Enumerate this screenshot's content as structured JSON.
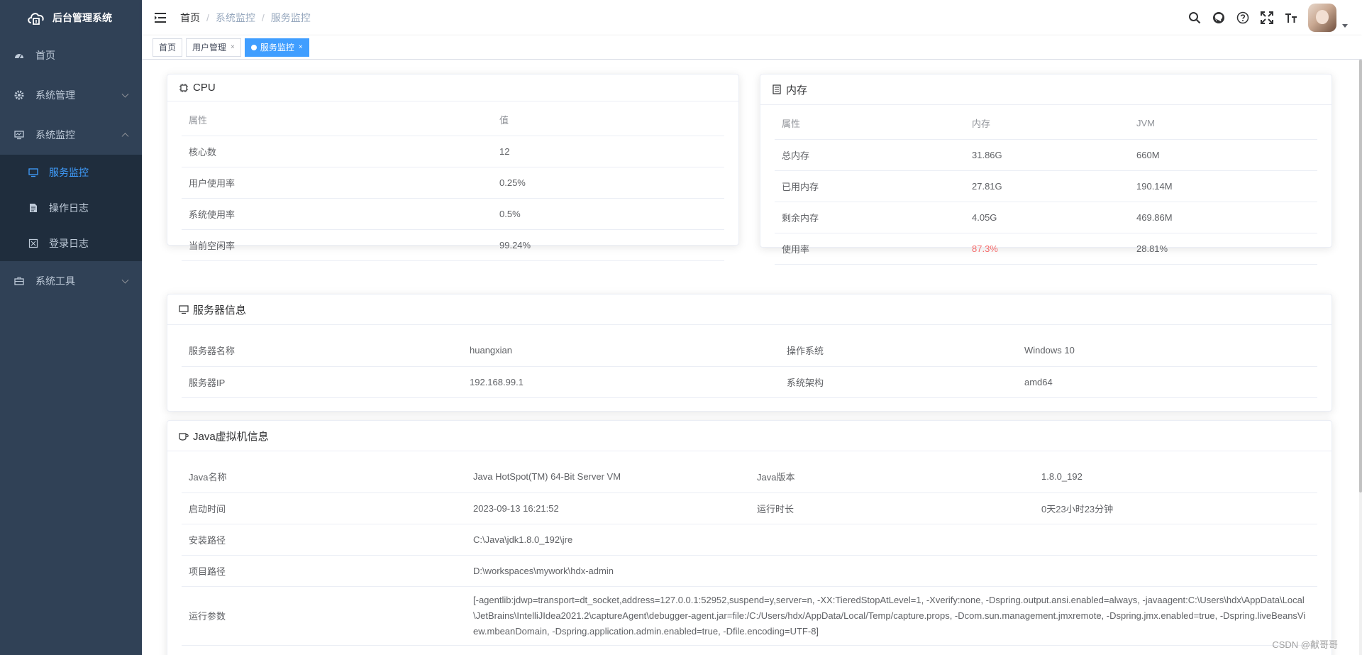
{
  "app": {
    "title": "后台管理系统"
  },
  "sidebar": {
    "items": [
      {
        "label": "首页",
        "icon": "dashboard-icon"
      },
      {
        "label": "系统管理",
        "icon": "gear-icon"
      },
      {
        "label": "系统监控",
        "icon": "monitor-icon"
      },
      {
        "label": "系统工具",
        "icon": "toolbox-icon"
      }
    ],
    "submenu": [
      {
        "label": "服务监控",
        "icon": "monitor-icon",
        "active": true
      },
      {
        "label": "操作日志",
        "icon": "log-icon"
      },
      {
        "label": "登录日志",
        "icon": "login-log-icon"
      }
    ]
  },
  "navbar": {
    "breadcrumb": [
      "首页",
      "系统监控",
      "服务监控"
    ]
  },
  "tags": [
    {
      "label": "首页"
    },
    {
      "label": "用户管理",
      "closable": true
    },
    {
      "label": "服务监控",
      "closable": true,
      "active": true
    }
  ],
  "cpu": {
    "title": "CPU",
    "headers": [
      "属性",
      "值"
    ],
    "rows": [
      [
        "核心数",
        "12"
      ],
      [
        "用户使用率",
        "0.25%"
      ],
      [
        "系统使用率",
        "0.5%"
      ],
      [
        "当前空闲率",
        "99.24%"
      ]
    ]
  },
  "memory": {
    "title": "内存",
    "headers": [
      "属性",
      "内存",
      "JVM"
    ],
    "rows": [
      [
        "总内存",
        "31.86G",
        "660M"
      ],
      [
        "已用内存",
        "27.81G",
        "190.14M"
      ],
      [
        "剩余内存",
        "4.05G",
        "469.86M"
      ],
      [
        "使用率",
        "87.3%",
        "28.81%"
      ]
    ],
    "danger_color": "#f56c6c"
  },
  "server": {
    "title": "服务器信息",
    "rows": [
      [
        "服务器名称",
        "huangxian",
        "操作系统",
        "Windows 10"
      ],
      [
        "服务器IP",
        "192.168.99.1",
        "系统架构",
        "amd64"
      ]
    ]
  },
  "jvm": {
    "title": "Java虚拟机信息",
    "rows": [
      [
        "Java名称",
        "Java HotSpot(TM) 64-Bit Server VM",
        "Java版本",
        "1.8.0_192"
      ],
      [
        "启动时间",
        "2023-09-13 16:21:52",
        "运行时长",
        "0天23小时23分钟"
      ]
    ],
    "install_path_label": "安装路径",
    "install_path": "C:\\Java\\jdk1.8.0_192\\jre",
    "project_path_label": "项目路径",
    "project_path": "D:\\workspaces\\mywork\\hdx-admin",
    "args_label": "运行参数",
    "args": "[-agentlib:jdwp=transport=dt_socket,address=127.0.0.1:52952,suspend=y,server=n, -XX:TieredStopAtLevel=1, -Xverify:none, -Dspring.output.ansi.enabled=always, -javaagent:C:\\Users\\hdx\\AppData\\Local\\JetBrains\\IntelliJIdea2021.2\\captureAgent\\debugger-agent.jar=file:/C:/Users/hdx/AppData/Local/Temp/capture.props, -Dcom.sun.management.jmxremote, -Dspring.jmx.enabled=true, -Dspring.liveBeansView.mbeanDomain, -Dspring.application.admin.enabled=true, -Dfile.encoding=UTF-8]"
  },
  "watermark": "CSDN @献哥哥",
  "colors": {
    "sidebar_bg": "#304156",
    "submenu_bg": "#1f2d3d",
    "accent": "#409eff"
  }
}
